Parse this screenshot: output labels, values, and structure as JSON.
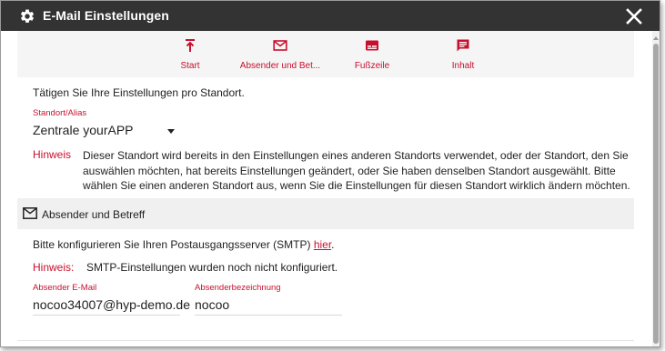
{
  "window": {
    "title": "E-Mail Einstellungen",
    "title_icon": "gear-icon",
    "close_icon": "close-icon"
  },
  "toolbar": {
    "accent_color": "#c8102e",
    "items": [
      {
        "label": "Start",
        "icon": "arrow-up-to-line-icon"
      },
      {
        "label": "Absender und Bet...",
        "icon": "envelope-icon"
      },
      {
        "label": "Fußzeile",
        "icon": "footer-icon"
      },
      {
        "label": "Inhalt",
        "icon": "message-icon"
      }
    ]
  },
  "intro_text": "Tätigen Sie Ihre Einstellungen pro Standort.",
  "location": {
    "label": "Standort/Alias",
    "value": "Zentrale yourAPP"
  },
  "hint": {
    "label": "Hinweis",
    "text": "Dieser Standort wird bereits in den Einstellungen eines anderen Standorts verwendet, oder der Standort, den Sie auswählen möchten, hat bereits Einstellungen geändert, oder Sie haben denselben Standort ausgewählt. Bitte wählen Sie einen anderen Standort aus, wenn Sie die Einstellungen für diesen Standort wirklich ändern möchten."
  },
  "section": {
    "title": "Absender und Betreff",
    "icon": "envelope-icon"
  },
  "smtp": {
    "text": "Bitte konfigurieren Sie Ihren Postausgangsserver (SMTP) ",
    "link": "hier",
    "suffix": "."
  },
  "hint2": {
    "label": "Hinweis:",
    "text": "SMTP-Einstellungen wurden noch nicht konfiguriert."
  },
  "fields": {
    "sender_email": {
      "label": "Absender E-Mail",
      "value": "nocoo34007@hyp-demo.de"
    },
    "sender_name": {
      "label": "Absenderbezeichnung",
      "value": "nocoo"
    }
  }
}
